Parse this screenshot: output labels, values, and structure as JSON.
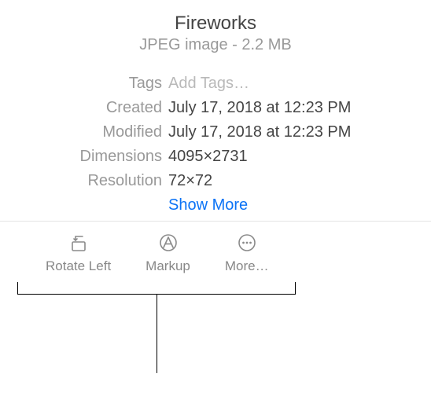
{
  "header": {
    "title": "Fireworks",
    "subtitle": "JPEG image - 2.2 MB"
  },
  "meta": {
    "tags_label": "Tags",
    "tags_placeholder": "Add Tags…",
    "created_label": "Created",
    "created_value": "July 17, 2018 at 12:23 PM",
    "modified_label": "Modified",
    "modified_value": "July 17, 2018 at 12:23 PM",
    "dimensions_label": "Dimensions",
    "dimensions_value": "4095×2731",
    "resolution_label": "Resolution",
    "resolution_value": "72×72",
    "show_more": "Show More"
  },
  "toolbar": {
    "rotate_left": "Rotate Left",
    "markup": "Markup",
    "more": "More…"
  },
  "icons": {
    "rotate_left": "rotate-left-icon",
    "markup": "markup-icon",
    "more": "more-icon"
  }
}
